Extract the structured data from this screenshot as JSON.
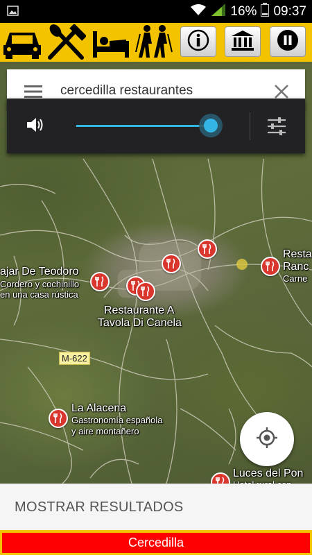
{
  "status_bar": {
    "battery": "16%",
    "time": "09:37"
  },
  "toolbar": {
    "icons": [
      "car-icon",
      "restaurant-icon",
      "bed-icon",
      "hikers-icon"
    ],
    "buttons": [
      "info-button",
      "museum-button",
      "pause-button"
    ]
  },
  "search": {
    "query": "cercedilla restaurantes"
  },
  "volume": {
    "level": 0.93,
    "accent": "#33b5e5"
  },
  "map": {
    "labels": [
      {
        "text": "ajar De Teodoro"
      },
      {
        "text": "Cordero y cochinillo"
      },
      {
        "text": "en una casa rústica"
      },
      {
        "text": "Restaurante A"
      },
      {
        "text": "Tavola Di Canela"
      },
      {
        "text": "La Alacena"
      },
      {
        "text": "Gastronomía española"
      },
      {
        "text": "y aire montañero"
      },
      {
        "text": "Resta"
      },
      {
        "text": "Ranc"
      },
      {
        "text": "Carne"
      },
      {
        "text": "Luces del Pon"
      },
      {
        "text": "Hotel rural con"
      }
    ],
    "road": "M-622"
  },
  "results": {
    "label": "MOSTRAR RESULTADOS"
  },
  "footer": {
    "place": "Cercedilla"
  },
  "colors": {
    "toolbar_yellow": "#f4c300",
    "poi_red": "#d9362e",
    "footer_red": "#ff0000"
  }
}
